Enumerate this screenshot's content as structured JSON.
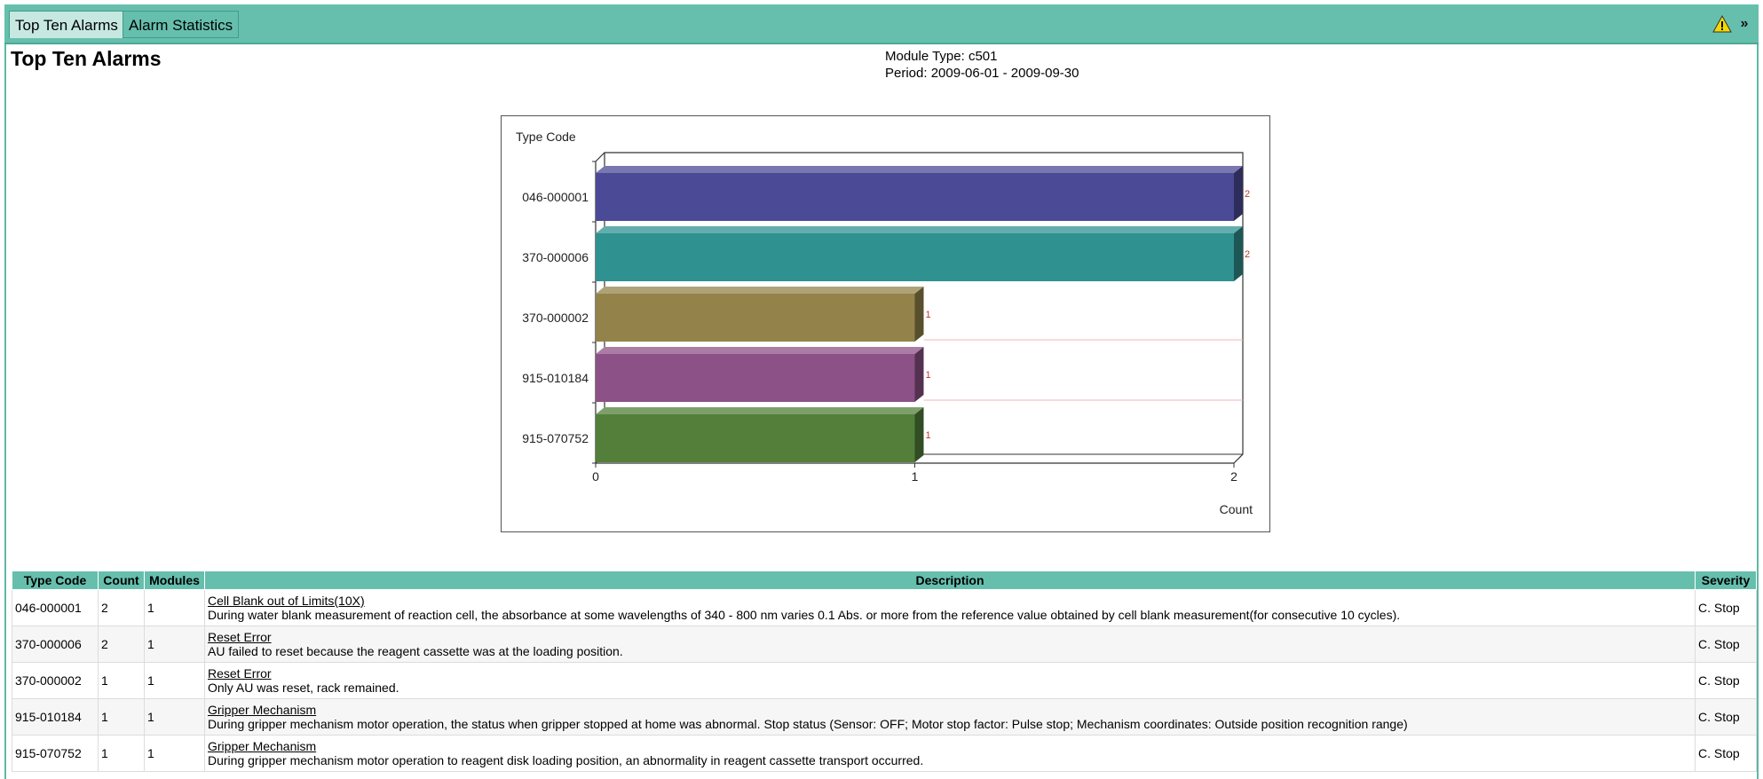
{
  "tabs": [
    {
      "label": "Top Ten Alarms",
      "active": true
    },
    {
      "label": "Alarm Statistics",
      "active": false
    }
  ],
  "header": {
    "title": "Top Ten Alarms",
    "module_type": "Module Type: c501",
    "period": "Period: 2009-06-01 - 2009-09-30"
  },
  "chart_data": {
    "type": "bar",
    "orientation": "horizontal",
    "categories": [
      "046-000001",
      "370-000006",
      "370-000002",
      "915-010184",
      "915-070752"
    ],
    "values": [
      2,
      2,
      1,
      1,
      1
    ],
    "colors": [
      "#4b4a96",
      "#2f9190",
      "#93834a",
      "#8c5186",
      "#537f3a"
    ],
    "ylabel": "Type Code",
    "xlabel": "Count",
    "xlim": [
      0,
      2
    ],
    "xticks": [
      "0",
      "1",
      "2"
    ],
    "data_labels": [
      "2",
      "2",
      "1",
      "1",
      "1"
    ]
  },
  "table": {
    "columns": [
      "Type Code",
      "Count",
      "Modules",
      "Description",
      "Severity"
    ],
    "rows": [
      {
        "code": "046-000001",
        "count": "2",
        "modules": "1",
        "title": "Cell Blank out of Limits(10X)",
        "text": "During water blank measurement of reaction cell, the absorbance at some wavelengths of 340 - 800 nm varies 0.1 Abs. or more from the reference value obtained by cell blank measurement(for consecutive 10 cycles).",
        "severity": "C. Stop"
      },
      {
        "code": "370-000006",
        "count": "2",
        "modules": "1",
        "title": "Reset Error",
        "text": "AU failed to reset because the reagent cassette was at the loading position.",
        "severity": "C. Stop"
      },
      {
        "code": "370-000002",
        "count": "1",
        "modules": "1",
        "title": "Reset Error",
        "text": "Only AU was reset, rack remained.",
        "severity": "C. Stop"
      },
      {
        "code": "915-010184",
        "count": "1",
        "modules": "1",
        "title": "Gripper Mechanism",
        "text": "During gripper mechanism motor operation, the status when gripper stopped at home was abnormal. Stop status (Sensor: OFF; Motor stop factor: Pulse stop; Mechanism coordinates: Outside position recognition range)",
        "severity": "C. Stop"
      },
      {
        "code": "915-070752",
        "count": "1",
        "modules": "1",
        "title": "Gripper Mechanism",
        "text": "During gripper mechanism motor operation to reagent disk loading position, an abnormality in reagent cassette transport occurred.",
        "severity": "C. Stop"
      }
    ]
  },
  "icons": {
    "warning": "warning-triangle-icon",
    "collapse": "double-chevron-down-icon"
  }
}
